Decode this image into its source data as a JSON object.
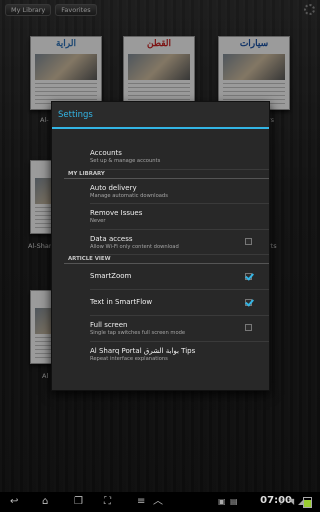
{
  "topbar": {
    "my_library": "My Library",
    "favorites": "Favorites"
  },
  "library": {
    "covers": [
      {
        "masthead": "الراية",
        "color": "#2a6cb0"
      },
      {
        "masthead": "القطن",
        "color": "#c02020"
      },
      {
        "masthead": "سيارات",
        "color": "#1a4f9e"
      },
      {
        "masthead": "",
        "color": "#3a6f2a"
      },
      {
        "masthead": "",
        "color": "#3a3a3a"
      }
    ],
    "labels": [
      "Al-",
      "rs",
      "Al-Shar",
      "rts",
      "Al"
    ]
  },
  "dialog": {
    "title": "Settings",
    "accounts": {
      "title": "Accounts",
      "summary": "Set up & manage accounts"
    },
    "section_library": "MY LIBRARY",
    "auto_delivery": {
      "title": "Auto delivery",
      "summary": "Manage automatic downloads"
    },
    "remove_issues": {
      "title": "Remove Issues",
      "summary": "Never"
    },
    "data_access": {
      "title": "Data access",
      "summary": "Allow Wi-Fi only content download",
      "checked": false
    },
    "section_article": "ARTICLE VIEW",
    "smart_zoom": {
      "title": "SmartZoom",
      "checked": true
    },
    "text_smartflow": {
      "title": "Text in SmartFlow",
      "checked": true
    },
    "full_screen": {
      "title": "Full screen",
      "summary": "Single tap switches full screen mode",
      "checked": false
    },
    "tips": {
      "title": "Al Sharq Portal بوابة الشرق Tips",
      "summary": "Repeat interface explanations"
    }
  },
  "accent_color": "#33b5e5",
  "statusbar": {
    "time": "07:00"
  }
}
